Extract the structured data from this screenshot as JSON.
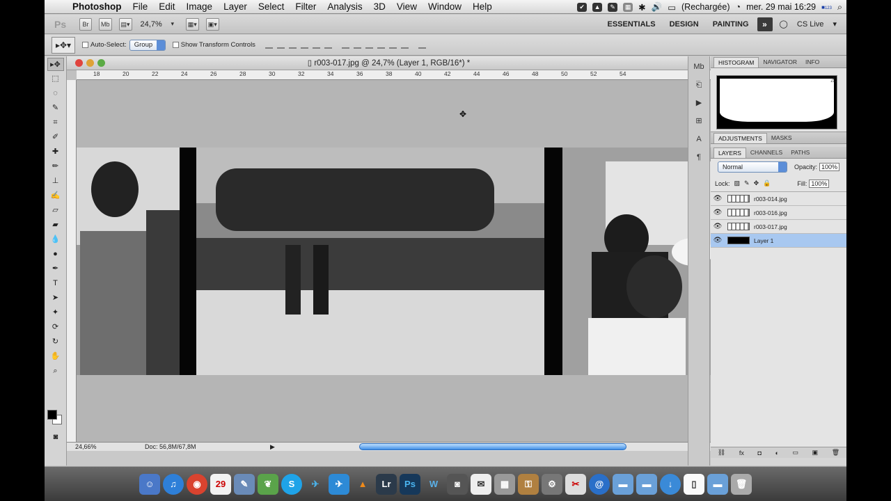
{
  "menubar": {
    "app_name": "Photoshop",
    "items": [
      "File",
      "Edit",
      "Image",
      "Layer",
      "Select",
      "Filter",
      "Analysis",
      "3D",
      "View",
      "Window",
      "Help"
    ],
    "battery_status": "(Rechargée)",
    "clock": "mer. 29 mai  16:29",
    "flag_badge": "123"
  },
  "appbar": {
    "logo": "Ps",
    "bridge_button": "Br",
    "minibridge_button": "Mb",
    "zoom_value": "24,7%",
    "workspaces": [
      "ESSENTIALS",
      "DESIGN",
      "PAINTING"
    ],
    "more_workspaces": "»",
    "cs_live": "CS Live"
  },
  "options": {
    "auto_select_label": "Auto-Select:",
    "auto_select_value": "Group",
    "show_transform_label": "Show Transform Controls"
  },
  "document": {
    "title": "r003-017.jpg @ 24,7% (Layer 1, RGB/16*) *",
    "ruler_ticks": [
      "18",
      "20",
      "22",
      "24",
      "26",
      "28",
      "30",
      "32",
      "34",
      "36",
      "38",
      "40",
      "42",
      "44",
      "46",
      "48",
      "50",
      "52",
      "54"
    ],
    "status_zoom": "24,66%",
    "status_doc": "Doc: 56,8M/67,8M"
  },
  "panels": {
    "top_tabs": [
      "HISTOGRAM",
      "NAVIGATOR",
      "INFO"
    ],
    "adj_tabs": [
      "ADJUSTMENTS",
      "MASKS"
    ],
    "layer_tabs": [
      "LAYERS",
      "CHANNELS",
      "PATHS"
    ],
    "blend_mode": "Normal",
    "opacity_label": "Opacity:",
    "opacity_value": "100%",
    "lock_label": "Lock:",
    "fill_label": "Fill:",
    "fill_value": "100%",
    "layers": [
      {
        "name": "r003-014.jpg"
      },
      {
        "name": "r003-016.jpg"
      },
      {
        "name": "r003-017.jpg"
      },
      {
        "name": "Layer 1"
      }
    ]
  },
  "dock": {
    "items": [
      "Finder",
      "iTunes",
      "Chrome",
      "iCal",
      "Preview",
      "Evernote",
      "Skype",
      "Twitter",
      "Tweetbot",
      "VLC",
      "Lightroom",
      "Photoshop",
      "Wunderlist",
      "Camera",
      "Notes",
      "Activity",
      "Keychain",
      "Utilities",
      "Automator",
      "Mail",
      "Safari",
      "Folder",
      "Applications",
      "Downloads",
      "Documents",
      "Trash"
    ]
  },
  "colors": {
    "selection_blue": "#a8c8f0",
    "scroll_blue": "#3f8ee6"
  }
}
